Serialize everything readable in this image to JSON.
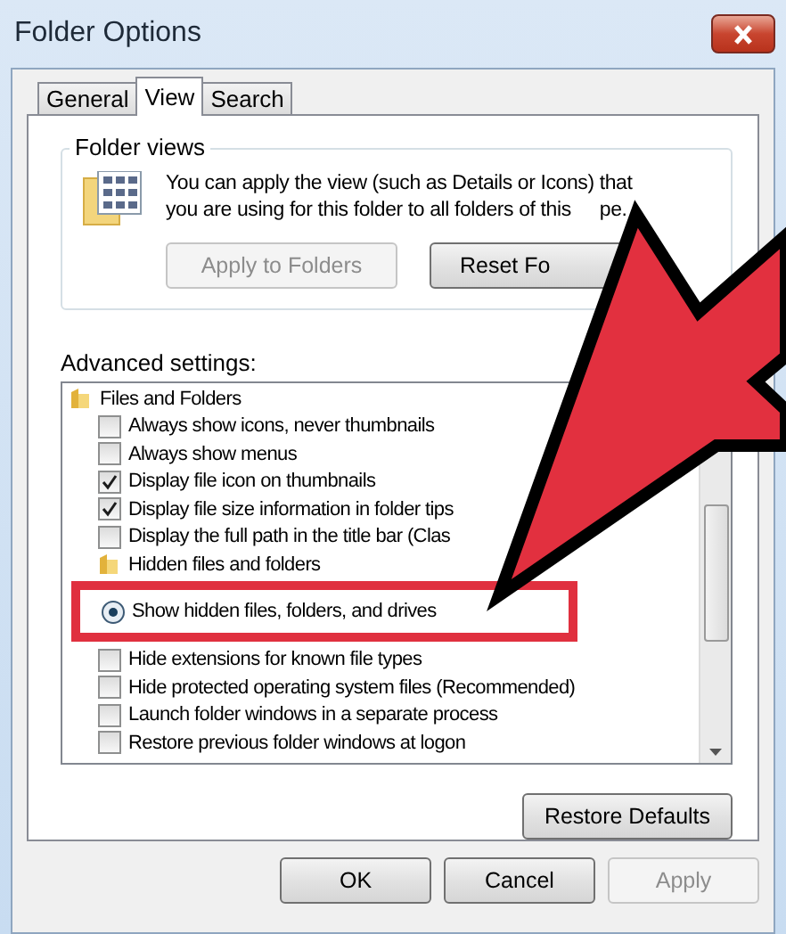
{
  "window": {
    "title": "Folder Options"
  },
  "tabs": [
    {
      "label": "General",
      "selected": false
    },
    {
      "label": "View",
      "selected": true
    },
    {
      "label": "Search",
      "selected": false
    }
  ],
  "folder_views": {
    "title": "Folder views",
    "description": [
      "You can apply the view (such as Details or Icons) that",
      "you are using for this folder to all folders of this"
    ],
    "description_tail": "pe.",
    "buttons": [
      {
        "label": "Apply to Folders",
        "disabled": true
      },
      {
        "label": "Reset Fo",
        "disabled": false
      }
    ]
  },
  "advanced": {
    "label": "Advanced settings:",
    "items": [
      {
        "kind": "folder",
        "label": "Files and Folders"
      },
      {
        "kind": "checkbox",
        "label": "Always show icons, never thumbnails",
        "checked": false
      },
      {
        "kind": "checkbox",
        "label": "Always show menus",
        "checked": false
      },
      {
        "kind": "checkbox",
        "label": "Display file icon on thumbnails",
        "checked": true
      },
      {
        "kind": "checkbox",
        "label": "Display file size information in folder tips",
        "checked": true
      },
      {
        "kind": "checkbox",
        "label": "Display the full path in the title bar (Clas",
        "checked": false
      },
      {
        "kind": "folder",
        "label": "Hidden files and folders"
      },
      {
        "kind": "radio",
        "label": "Show hidden files, folders, and drives",
        "selected": true,
        "highlighted": true
      },
      {
        "kind": "checkbox",
        "label": "Hide extensions for known file types",
        "checked": false
      },
      {
        "kind": "checkbox",
        "label": "Hide protected operating system files (Recommended)",
        "checked": false
      },
      {
        "kind": "checkbox",
        "label": "Launch folder windows in a separate process",
        "checked": false
      },
      {
        "kind": "checkbox",
        "label": "Restore previous folder windows at logon",
        "checked": false
      }
    ]
  },
  "restore_button": {
    "label": "Restore Defaults"
  },
  "footer_buttons": [
    {
      "label": "OK",
      "disabled": false
    },
    {
      "label": "Cancel",
      "disabled": false
    },
    {
      "label": "Apply",
      "disabled": true
    }
  ]
}
